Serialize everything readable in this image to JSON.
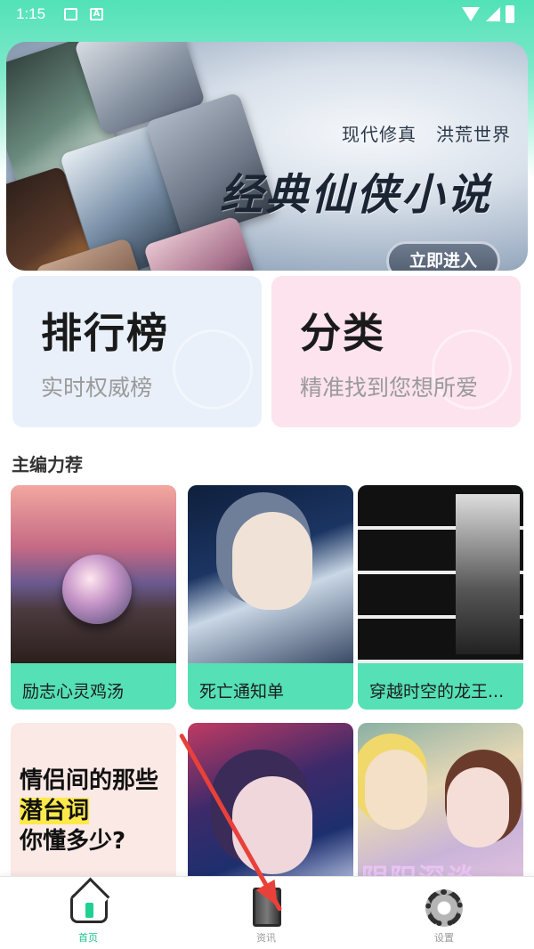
{
  "status_bar": {
    "time": "1:15",
    "notif_badge": "A"
  },
  "banner": {
    "subtitle_left": "现代修真",
    "subtitle_right": "洪荒世界",
    "title": "经典仙侠小说",
    "button_label": "立即进入"
  },
  "categories": [
    {
      "title": "排行榜",
      "desc": "实时权威榜"
    },
    {
      "title": "分类",
      "desc": "精准找到您想所爱"
    }
  ],
  "section": {
    "title": "主编力荐"
  },
  "books": [
    {
      "label": "励志心灵鸡汤"
    },
    {
      "label": "死亡通知单"
    },
    {
      "label": "穿越时空的龙王..."
    },
    {
      "label": "",
      "cover_text_1": "情侣间的那些",
      "cover_text_2": "潜台词",
      "cover_text_3": "你懂多少?"
    },
    {
      "label": ""
    },
    {
      "label": "",
      "cover_text": "阴阳深谈"
    }
  ],
  "bottom_nav": {
    "home": "首页",
    "news": "资讯",
    "settings": "设置"
  },
  "colors": {
    "accent": "#52e2b8",
    "nav_active": "#1fbf8f",
    "arrow": "#e8413a"
  }
}
